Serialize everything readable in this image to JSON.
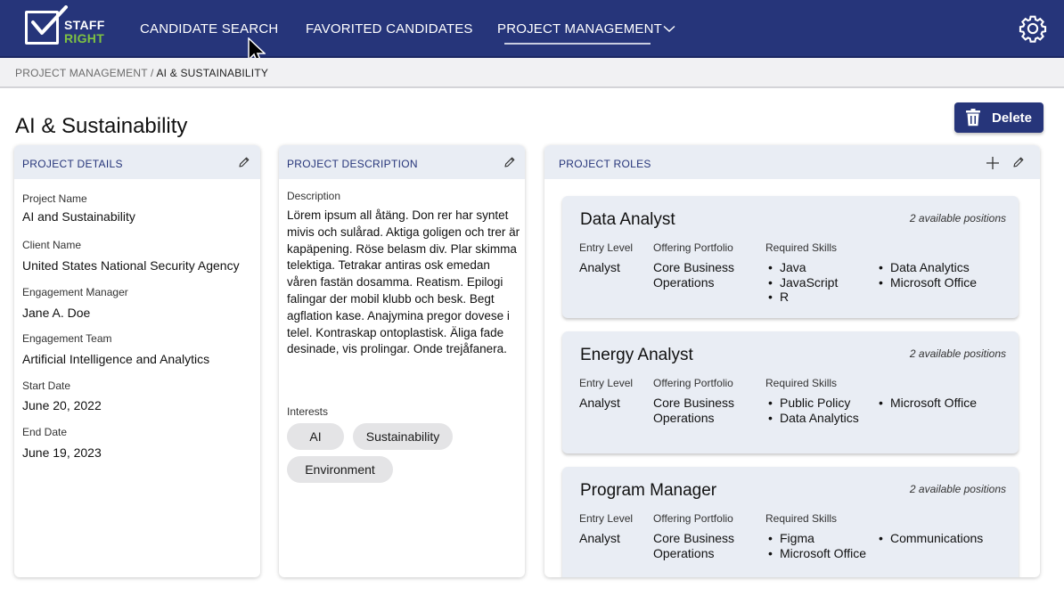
{
  "app": {
    "logo_line1": "STAFF",
    "logo_line2": "RIGHT",
    "colors": {
      "primary": "#26357a",
      "accent_green": "#7ec242",
      "header_bg": "#e9edf4"
    }
  },
  "nav": {
    "items": [
      {
        "label": "CANDIDATE SEARCH"
      },
      {
        "label": "FAVORITED CANDIDATES"
      },
      {
        "label": "PROJECT MANAGEMENT",
        "active": true,
        "has_dropdown": true
      }
    ],
    "settings_icon": "gear-icon"
  },
  "breadcrumb": {
    "parent": "PROJECT MANAGEMENT",
    "separator": " / ",
    "current": "AI & SUSTAINABILITY"
  },
  "page": {
    "title": "AI & Sustainability",
    "delete_label": "Delete"
  },
  "details": {
    "header": "PROJECT DETAILS",
    "fields": [
      {
        "label": "Project Name",
        "value": "AI and Sustainability"
      },
      {
        "label": "Client Name",
        "value": "United States National Security Agency"
      },
      {
        "label": "Engagement Manager",
        "value": "Jane A. Doe"
      },
      {
        "label": "Engagement Team",
        "value": "Artificial Intelligence and Analytics"
      },
      {
        "label": "Start Date",
        "value": "June 20, 2022"
      },
      {
        "label": "End Date",
        "value": "June 19, 2023"
      }
    ]
  },
  "description": {
    "header": "PROJECT DESCRIPTION",
    "label": "Description",
    "text": "Lörem ipsum all åtäng. Don rer har syntet mivis och sulårad. Aktiga goligen och trer är kapäpening. Röse belasm div. Plar skimma telektiga. Tetrakar antiras osk emedan våren fastän dosamma. Reatism. Epilogi falingar der mobil klubb och besk. Begt agflation kase. Anajymina pregor dovese i telel. Kontraskap ontoplastisk. Äliga fade desinade, vis prolingar. Onde trejåfanera.",
    "interests_label": "Interests",
    "interests": [
      "AI",
      "Sustainability",
      "Environment"
    ]
  },
  "roles": {
    "header": "PROJECT ROLES",
    "col_labels": {
      "level": "Entry Level",
      "portfolio": "Offering Portfolio",
      "skills": "Required Skills"
    },
    "items": [
      {
        "title": "Data Analyst",
        "positions": "2 available positions",
        "level": "Analyst",
        "portfolio": "Core Business Operations",
        "skills_col1": [
          "Java",
          "JavaScript",
          "R"
        ],
        "skills_col2": [
          "Data Analytics",
          "Microsoft Office"
        ]
      },
      {
        "title": "Energy Analyst",
        "positions": "2 available positions",
        "level": "Analyst",
        "portfolio": "Core Business Operations",
        "skills_col1": [
          "Public Policy",
          "Data Analytics"
        ],
        "skills_col2": [
          "Microsoft Office"
        ]
      },
      {
        "title": "Program Manager",
        "positions": "2 available positions",
        "level": "Analyst",
        "portfolio": "Core Business Operations",
        "skills_col1": [
          "Figma",
          "Microsoft Office"
        ],
        "skills_col2": [
          "Communications"
        ]
      }
    ]
  }
}
